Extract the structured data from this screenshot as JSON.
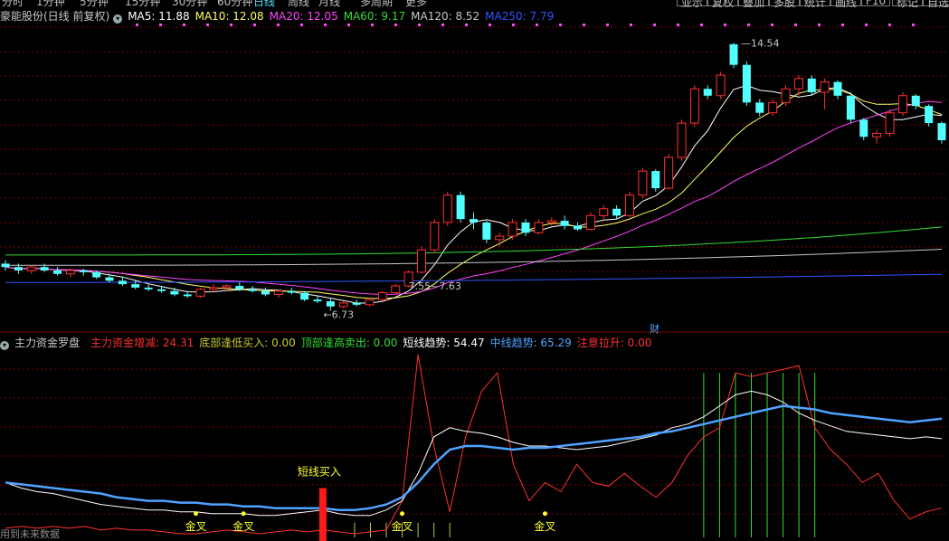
{
  "topbar": {
    "tabs": [
      "分时",
      "1分钟",
      "5分钟",
      "15分钟",
      "30分钟",
      "60分钟",
      "日线",
      "周线",
      "月线",
      "多周期",
      "更多"
    ],
    "active_tab": "日线",
    "right_buttons": [
      "亚示",
      "复权",
      "叠加",
      "多股",
      "统计",
      "画线",
      "F10",
      "标记",
      "自选"
    ]
  },
  "main": {
    "stock_label": "豪能股份(日线 前复权)",
    "ma": [
      {
        "label": "MA5: 11.88",
        "color": "#ffffff"
      },
      {
        "label": "MA10: 12.08",
        "color": "#ffff66"
      },
      {
        "label": "MA20: 12.05",
        "color": "#ff44ff"
      },
      {
        "label": "MA60: 9.17",
        "color": "#33dd33"
      },
      {
        "label": "MA120: 8.52",
        "color": "#c8c8c8"
      },
      {
        "label": "MA250: 7.79",
        "color": "#3355ff"
      }
    ],
    "high_label": "14.54",
    "low_label": "6.73",
    "mid_label": "7.55~7.63",
    "finance_badge": "财"
  },
  "indicator": {
    "name": "主力资金罗盘",
    "params": [
      {
        "label": "主力资金增减: 24.31",
        "color": "#ff3030"
      },
      {
        "label": "底部逢低买入: 0.00",
        "color": "#c8c832"
      },
      {
        "label": "顶部逢高卖出: 0.00",
        "color": "#33dd33"
      },
      {
        "label": "短线趋势: 54.47",
        "color": "#ffffff"
      },
      {
        "label": "中线趋势: 65.29",
        "color": "#4fa3ff"
      },
      {
        "label": "注意拉升: 0.00",
        "color": "#ff3030"
      }
    ],
    "buy_label": "短线买入",
    "golden_cross": "金叉",
    "footer_note": "用到未来数据"
  },
  "chart_data": [
    {
      "type": "candlestick",
      "title": "豪能股份(日线 前复权)",
      "ohlc": [
        [
          8.1,
          8.2,
          7.9,
          8.0
        ],
        [
          8.0,
          8.1,
          7.8,
          7.9
        ],
        [
          7.9,
          8.05,
          7.8,
          8.0
        ],
        [
          8.0,
          8.1,
          7.85,
          7.9
        ],
        [
          7.9,
          8.0,
          7.75,
          7.8
        ],
        [
          7.8,
          7.95,
          7.7,
          7.9
        ],
        [
          7.9,
          7.95,
          7.75,
          7.85
        ],
        [
          7.85,
          7.9,
          7.65,
          7.7
        ],
        [
          7.7,
          7.8,
          7.55,
          7.6
        ],
        [
          7.6,
          7.7,
          7.45,
          7.5
        ],
        [
          7.5,
          7.6,
          7.35,
          7.4
        ],
        [
          7.4,
          7.5,
          7.3,
          7.35
        ],
        [
          7.35,
          7.45,
          7.25,
          7.3
        ],
        [
          7.3,
          7.4,
          7.15,
          7.2
        ],
        [
          7.2,
          7.3,
          7.1,
          7.15
        ],
        [
          7.15,
          7.4,
          7.1,
          7.35
        ],
        [
          7.35,
          7.5,
          7.25,
          7.4
        ],
        [
          7.4,
          7.5,
          7.3,
          7.45
        ],
        [
          7.45,
          7.55,
          7.3,
          7.35
        ],
        [
          7.35,
          7.45,
          7.25,
          7.3
        ],
        [
          7.3,
          7.4,
          7.15,
          7.2
        ],
        [
          7.2,
          7.35,
          7.1,
          7.3
        ],
        [
          7.3,
          7.4,
          7.2,
          7.25
        ],
        [
          7.25,
          7.3,
          7.0,
          7.05
        ],
        [
          7.05,
          7.15,
          6.95,
          7.0
        ],
        [
          7.0,
          7.1,
          6.73,
          6.85
        ],
        [
          6.85,
          7.0,
          6.8,
          6.95
        ],
        [
          6.95,
          7.05,
          6.85,
          6.9
        ],
        [
          6.9,
          7.1,
          6.85,
          7.05
        ],
        [
          7.05,
          7.3,
          7.0,
          7.25
        ],
        [
          7.25,
          7.5,
          7.2,
          7.45
        ],
        [
          7.45,
          7.9,
          7.4,
          7.85
        ],
        [
          7.85,
          8.6,
          7.8,
          8.5
        ],
        [
          8.5,
          9.4,
          8.4,
          9.3
        ],
        [
          9.3,
          10.2,
          9.2,
          10.1
        ],
        [
          10.1,
          10.2,
          9.3,
          9.4
        ],
        [
          9.4,
          9.6,
          9.1,
          9.3
        ],
        [
          9.3,
          9.35,
          8.7,
          8.8
        ],
        [
          8.8,
          9.0,
          8.6,
          8.9
        ],
        [
          8.9,
          9.4,
          8.8,
          9.3
        ],
        [
          9.3,
          9.4,
          8.9,
          9.0
        ],
        [
          9.0,
          9.4,
          8.95,
          9.3
        ],
        [
          9.3,
          9.45,
          9.2,
          9.35
        ],
        [
          9.35,
          9.5,
          9.1,
          9.2
        ],
        [
          9.2,
          9.3,
          9.05,
          9.1
        ],
        [
          9.1,
          9.6,
          9.05,
          9.5
        ],
        [
          9.5,
          9.8,
          9.4,
          9.7
        ],
        [
          9.7,
          9.8,
          9.4,
          9.5
        ],
        [
          9.5,
          10.2,
          9.45,
          10.1
        ],
        [
          10.1,
          10.9,
          10.0,
          10.8
        ],
        [
          10.8,
          10.85,
          10.2,
          10.3
        ],
        [
          10.3,
          11.3,
          10.25,
          11.2
        ],
        [
          11.2,
          12.3,
          11.1,
          12.2
        ],
        [
          12.2,
          13.3,
          12.1,
          13.2
        ],
        [
          13.2,
          13.3,
          12.9,
          13.0
        ],
        [
          13.0,
          13.7,
          12.9,
          13.6
        ],
        [
          14.5,
          14.54,
          13.8,
          13.9
        ],
        [
          13.9,
          14.0,
          12.7,
          12.8
        ],
        [
          12.8,
          12.9,
          12.4,
          12.5
        ],
        [
          12.5,
          12.9,
          12.4,
          12.8
        ],
        [
          12.8,
          13.3,
          12.7,
          13.2
        ],
        [
          13.2,
          13.6,
          13.0,
          13.5
        ],
        [
          13.5,
          13.6,
          13.0,
          13.1
        ],
        [
          13.1,
          13.5,
          12.6,
          13.4
        ],
        [
          13.4,
          13.45,
          12.9,
          13.0
        ],
        [
          13.0,
          13.1,
          12.2,
          12.3
        ],
        [
          12.3,
          12.35,
          11.7,
          11.8
        ],
        [
          11.8,
          12.0,
          11.6,
          11.9
        ],
        [
          11.9,
          12.6,
          11.8,
          12.5
        ],
        [
          12.5,
          13.1,
          12.4,
          13.0
        ],
        [
          13.0,
          13.05,
          12.6,
          12.7
        ],
        [
          12.7,
          12.75,
          12.1,
          12.2
        ],
        [
          12.2,
          12.25,
          11.6,
          11.7
        ]
      ],
      "ma": {
        "MA5": 11.88,
        "MA10": 12.08,
        "MA20": 12.05,
        "MA60": 9.17,
        "MA120": 8.52,
        "MA250": 7.79
      },
      "ylim": [
        6.5,
        15.0
      ],
      "high": 14.54,
      "low": 6.73,
      "grid": true
    },
    {
      "type": "line",
      "title": "主力资金罗盘",
      "ylim": [
        0,
        100
      ],
      "series": [
        {
          "name": "主力资金增减",
          "color": "#ff3030",
          "values": [
            5,
            6,
            5,
            6,
            5,
            6,
            4,
            5,
            4,
            4,
            3,
            2,
            2,
            3,
            4,
            3,
            2,
            3,
            4,
            3,
            4,
            3,
            2,
            3,
            4,
            20,
            100,
            50,
            14,
            55,
            80,
            90,
            40,
            20,
            30,
            25,
            40,
            30,
            28,
            35,
            28,
            22,
            30,
            45,
            55,
            60,
            90,
            88,
            90,
            92,
            94,
            60,
            48,
            40,
            30,
            35,
            20,
            10,
            14,
            16
          ]
        },
        {
          "name": "短线趋势",
          "color": "#ffffff",
          "values": [
            30,
            27,
            25,
            24,
            22,
            20,
            18,
            17,
            16,
            15,
            15,
            14,
            14,
            13,
            13,
            13,
            12,
            12,
            13,
            14,
            15,
            13,
            12,
            12,
            15,
            20,
            35,
            55,
            60,
            58,
            57,
            55,
            52,
            50,
            50,
            49,
            48,
            49,
            50,
            52,
            54,
            56,
            60,
            62,
            66,
            72,
            78,
            80,
            78,
            74,
            68,
            64,
            61,
            58,
            57,
            56,
            55,
            54,
            55,
            54
          ]
        },
        {
          "name": "中线趋势",
          "color": "#4fa3ff",
          "values": [
            30,
            29,
            28,
            27,
            26,
            25,
            24,
            22,
            21,
            20,
            20,
            19,
            19,
            18,
            18,
            17,
            17,
            16,
            16,
            16,
            16,
            15,
            15,
            16,
            18,
            22,
            30,
            40,
            48,
            50,
            50,
            49,
            48,
            49,
            49,
            50,
            51,
            52,
            53,
            54,
            55,
            57,
            58,
            60,
            62,
            64,
            66,
            68,
            70,
            72,
            71,
            70,
            68,
            67,
            66,
            65,
            64,
            63,
            64,
            65
          ]
        }
      ],
      "markers": [
        "短线买入",
        "金叉",
        "金叉",
        "金叉",
        "金叉"
      ]
    }
  ]
}
